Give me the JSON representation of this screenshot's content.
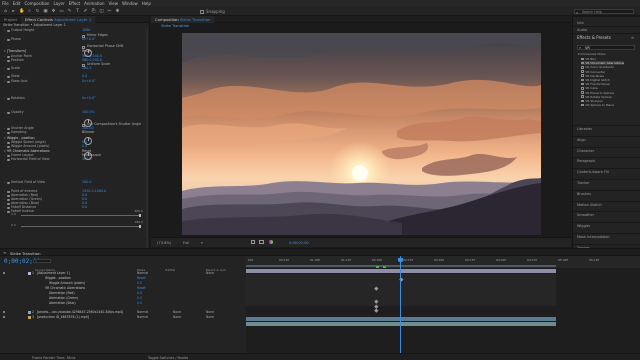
{
  "menu": [
    "File",
    "Edit",
    "Composition",
    "Layer",
    "Effect",
    "Animation",
    "View",
    "Window",
    "Help"
  ],
  "toolbar": {
    "snapping_label": "Snapping",
    "search_help": "Search Help",
    "tools": [
      "home-icon",
      "selection-icon",
      "hand-icon",
      "zoom-icon",
      "rotate-icon",
      "camera-icon",
      "pan-icon",
      "rectangle-icon",
      "pen-icon",
      "type-icon",
      "brush-icon",
      "clone-icon",
      "eraser-icon",
      "roto-icon",
      "pin-icon"
    ]
  },
  "effect_controls": {
    "tab_project": "Project",
    "tab_prefix": "Effect Controls",
    "tab_layer": "Adjustment Layer 1",
    "header": "Strike Transition • Adjustment Layer 1",
    "rows": [
      {
        "label": "Output Height",
        "value": "1080"
      },
      {
        "label": "",
        "value": "",
        "check": "Mirror Edges"
      },
      {
        "label": "Phase",
        "value": "0x+0.0°"
      },
      {
        "label": "",
        "value": "",
        "check": "Horizontal Phase Shift"
      },
      {
        "label": "[Transform]",
        "value": "Reset"
      },
      {
        "label": "Anchor Point",
        "value": "960.0,540.0"
      },
      {
        "label": "Position",
        "value": "960.0,540.0"
      },
      {
        "label": "",
        "value": "",
        "check": "Uniform Scale"
      },
      {
        "label": "Scale",
        "value": "100.0"
      },
      {
        "label": "Skew",
        "value": "0.0"
      },
      {
        "label": "Skew Axis",
        "value": "0x+0.0°"
      },
      {
        "label": "Rotation",
        "value": "0x+0.0°"
      },
      {
        "label": "Opacity",
        "value": "100.0%"
      },
      {
        "label": "",
        "value": "",
        "check": "Use Composition's Shutter Angle"
      },
      {
        "label": "Shutter Angle",
        "value": "180.00"
      },
      {
        "label": "Sampling",
        "value": "Bilinear"
      },
      {
        "label": "Wiggle - position",
        "value": ""
      },
      {
        "label": "Wiggle Speed (wig/s)",
        "value": "0.0"
      },
      {
        "label": "Wiggle Amount (pixels)",
        "value": "0.0"
      },
      {
        "label": "VR Chromatic Aberrations",
        "value": "Reset"
      },
      {
        "label": "Frame Layout",
        "value": "Monoscopic"
      },
      {
        "label": "Horizontal Field of View",
        "value": "360.0"
      },
      {
        "label": "Vertical Field of View",
        "value": "180.0"
      },
      {
        "label": "Point of Interest",
        "value": "1920.0,1080.0"
      },
      {
        "label": "Aberration (Red)",
        "value": "0.0"
      },
      {
        "label": "Aberration (Green)",
        "value": "0.0"
      },
      {
        "label": "Aberration (Blue)",
        "value": "0.0"
      },
      {
        "label": "Falloff Distance",
        "value": "0.0"
      },
      {
        "label": "Falloff Inverse",
        "value": ""
      }
    ],
    "slider_max_a": "360.0",
    "slider_min_a": "0.0",
    "slider_max_b": "180.0",
    "slider_min_b": "0.0"
  },
  "composition": {
    "tab_label": "Composition",
    "tab_name": "Strike Transition",
    "sub_tab": "Strike Transition",
    "zoom": "(73.6%)",
    "resolution": "Full",
    "timecode": "0;00;02;00",
    "camera": "Active Camera",
    "views": "1 View"
  },
  "right_panel": {
    "search_help": "Search Help",
    "info": "Info",
    "audio": "Audio",
    "effects_presets": "Effects & Presets",
    "search_value": "VR",
    "folder": "Immersive Video",
    "effects": [
      "VR Blur",
      "VR Chromatic Aberrations",
      "VR Color Gradients",
      "VR Converter",
      "VR De-Noise",
      "VR Digital Glitch",
      "VR Fractal Noise",
      "VR Glow",
      "VR Plane to Sphere",
      "VR Rotate Sphere",
      "VR Sharpen",
      "VR Sphere to Plane"
    ],
    "selected_effect": "VR Chromatic Aberrations",
    "panels": [
      "Libraries",
      "Align",
      "Character",
      "Paragraph",
      "Content-Aware Fill",
      "Tracker",
      "Brushes",
      "Motion Sketch",
      "Smoother",
      "Wiggler",
      "Mask Interpolation",
      "Tracker"
    ]
  },
  "timeline": {
    "tab": "Strike Transition",
    "timecode": "0;00;02;00",
    "cols": {
      "source": "Source Name",
      "mode": "Mode",
      "trkmat": "TrkMat",
      "parent": "Parent & Link"
    },
    "layers": [
      {
        "num": "1",
        "name": "[Adjustment Layer 1]",
        "mode": "Normal",
        "trk": "",
        "parent": "None"
      },
      {
        "num": "",
        "name": "Wiggle - position",
        "mode": "Reset",
        "trk": "",
        "parent": ""
      },
      {
        "num": "",
        "name": "Wiggle Amount (pixels)",
        "mode": "0.0",
        "trk": "",
        "parent": ""
      },
      {
        "num": "",
        "name": "VR Chromatic Aberrations",
        "mode": "Reset",
        "trk": "",
        "parent": ""
      },
      {
        "num": "",
        "name": "Aberration (Red)",
        "mode": "0.0",
        "trk": "",
        "parent": ""
      },
      {
        "num": "",
        "name": "Aberration (Green)",
        "mode": "0.0",
        "trk": "",
        "parent": ""
      },
      {
        "num": "",
        "name": "Aberration (Blue)",
        "mode": "0.0",
        "trk": "",
        "parent": ""
      },
      {
        "num": "2",
        "name": "[pexels-...ion-youtube-4298447-2560x1440-30fps.mp4]",
        "mode": "Normal",
        "trk": "None",
        "parent": "None"
      },
      {
        "num": "3",
        "name": "[production ID_4647876 (1).mp4]",
        "mode": "Normal",
        "trk": "None",
        "parent": "None"
      }
    ],
    "ruler": [
      "00f",
      "00:15f",
      "01:00f",
      "01:15f",
      "02:00f",
      "02:15f",
      "03:00f",
      "03:15f",
      "04:00f",
      "04:15f",
      "05:00f",
      "05:15f"
    ],
    "render_time": "Frame Render Time: 38ms",
    "toggle": "Toggle Switches / Modes"
  },
  "colors": {
    "accent": "#2d8ceb",
    "label_adjust": "#b8b8d6",
    "label_video": "#7ea7c8",
    "label_video2": "#c5a25a"
  }
}
